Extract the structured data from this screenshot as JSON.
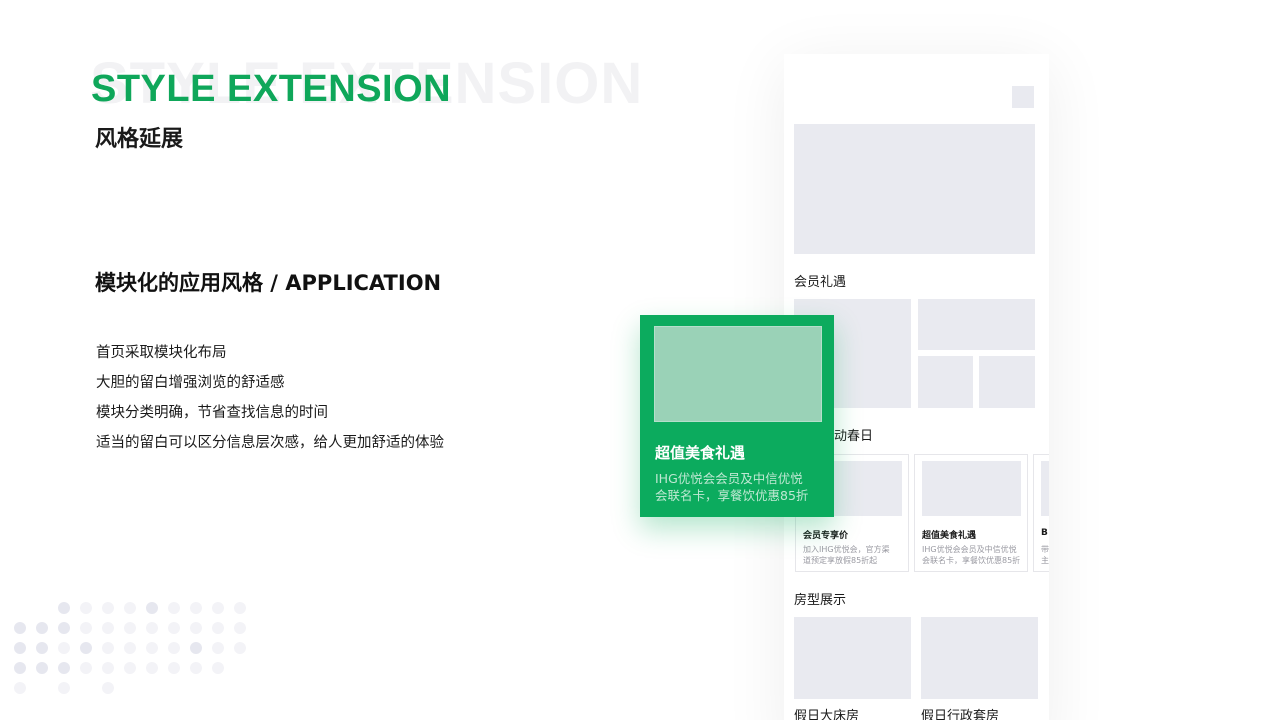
{
  "header": {
    "bg_title": "STYLE EXTENSION",
    "title": "STYLE EXTENSION",
    "subtitle": "风格延展"
  },
  "section": {
    "heading": "模块化的应用风格 / APPLICATION",
    "bullets": [
      "首页采取模块化布局",
      "大胆的留白增强浏览的舒适感",
      "模块分类明确，节省查找信息的时间",
      "适当的留白可以区分信息层次感，给人更加舒适的体验"
    ]
  },
  "phone": {
    "section_member": "会员礼遇",
    "section_spring": "动春日",
    "section_rooms": "房型展示",
    "cards": [
      {
        "title": "会员专享价",
        "desc_1": "加入IHG优悦会，官方渠",
        "desc_2": "道预定享放假85折起"
      },
      {
        "title": "超值美食礼遇",
        "desc_1": "IHG优悦会会员及中信优悦",
        "desc_2": "会联名卡，享餐饮优惠85折"
      },
      {
        "title": "B",
        "desc_1": "带",
        "desc_2": "主"
      }
    ],
    "rooms": [
      "假日大床房",
      "假日行政套房"
    ]
  },
  "highlight_card": {
    "title": "超值美食礼遇",
    "desc_1": "IHG优悦会会员及中信优悦",
    "desc_2": "会联名卡，享餐饮优惠85折"
  },
  "colors": {
    "accent": "#0fa75a",
    "card_green": "#0cab5e",
    "placeholder": "#e9eaf0"
  }
}
